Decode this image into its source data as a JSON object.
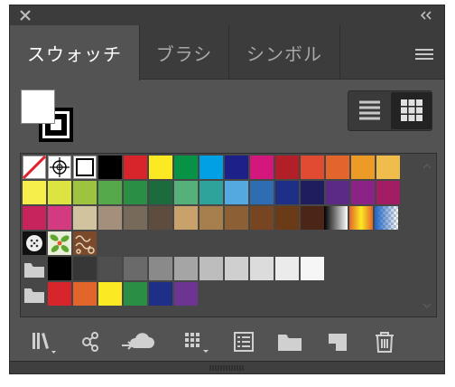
{
  "tabs": [
    {
      "label": "スウォッチ",
      "active": true
    },
    {
      "label": "ブラシ",
      "active": false
    },
    {
      "label": "シンボル",
      "active": false
    }
  ],
  "colors": {
    "panel_bg": "#535353",
    "tab_bar_bg": "#3c3c3c",
    "swatch_bg": "#474747"
  },
  "swatch_rows": [
    [
      "#000000",
      "#d7252b",
      "#fbe923",
      "#079345",
      "#00a0e4",
      "#1d2088",
      "#d4177d",
      "#b21f29",
      "#e04b32",
      "#e2652b",
      "#ec9b26",
      "#f0bc4b"
    ],
    [
      "#f6ee4b",
      "#dde43f",
      "#9ec43f",
      "#55a94b",
      "#2a8f45",
      "#1b6b3d",
      "#55b07a",
      "#2ea39c",
      "#53a9e0",
      "#2e6db2",
      "#1d2f86",
      "#1e1d5d",
      "#5b2a86",
      "#8a2385",
      "#a21d63"
    ],
    [
      "#c7245d",
      "#d43a80",
      "#d2c3a0",
      "#a48f7a",
      "#776a5b",
      "#5e4d3f",
      "#c9a26b",
      "#a77f4c",
      "#8c5f34",
      "#784523",
      "#6b3a16",
      "#4b2616"
    ],
    [],
    [
      "#000000",
      "#373737",
      "#4f4f4f",
      "#6a6a6a",
      "#8a8a8a",
      "#a5a5a5",
      "#bdbdbd",
      "#cfcfcf",
      "#dcdcdc",
      "#ebebeb",
      "#f6f6f6"
    ],
    [
      "#d7252b",
      "#e2652b",
      "#fbe923",
      "#2a8f45",
      "#1d2f86",
      "#6e3491"
    ]
  ],
  "icons": {
    "close": "close-icon",
    "collapse": "double-chevron-left-icon",
    "menu": "hamburger-menu-icon",
    "list_view": "list-view-icon",
    "grid_view": "grid-view-icon",
    "library": "swatch-library-icon",
    "share": "share-icon",
    "cloud": "add-to-library-icon",
    "kind": "swatch-kind-icon",
    "options": "swatch-options-icon",
    "group": "new-color-group-icon",
    "new": "new-swatch-icon",
    "delete": "delete-swatch-icon"
  }
}
